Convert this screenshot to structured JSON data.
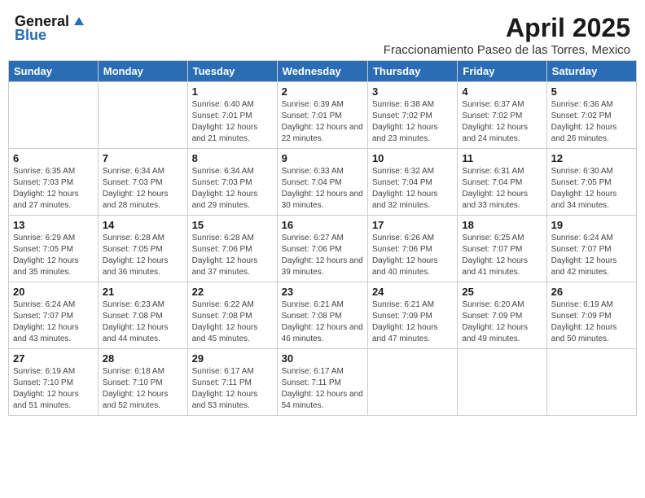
{
  "header": {
    "logo_general": "General",
    "logo_blue": "Blue",
    "title": "April 2025",
    "subtitle": "Fraccionamiento Paseo de las Torres, Mexico"
  },
  "weekdays": [
    "Sunday",
    "Monday",
    "Tuesday",
    "Wednesday",
    "Thursday",
    "Friday",
    "Saturday"
  ],
  "weeks": [
    [
      {
        "day": "",
        "info": ""
      },
      {
        "day": "",
        "info": ""
      },
      {
        "day": "1",
        "info": "Sunrise: 6:40 AM\nSunset: 7:01 PM\nDaylight: 12 hours and 21 minutes."
      },
      {
        "day": "2",
        "info": "Sunrise: 6:39 AM\nSunset: 7:01 PM\nDaylight: 12 hours and 22 minutes."
      },
      {
        "day": "3",
        "info": "Sunrise: 6:38 AM\nSunset: 7:02 PM\nDaylight: 12 hours and 23 minutes."
      },
      {
        "day": "4",
        "info": "Sunrise: 6:37 AM\nSunset: 7:02 PM\nDaylight: 12 hours and 24 minutes."
      },
      {
        "day": "5",
        "info": "Sunrise: 6:36 AM\nSunset: 7:02 PM\nDaylight: 12 hours and 26 minutes."
      }
    ],
    [
      {
        "day": "6",
        "info": "Sunrise: 6:35 AM\nSunset: 7:03 PM\nDaylight: 12 hours and 27 minutes."
      },
      {
        "day": "7",
        "info": "Sunrise: 6:34 AM\nSunset: 7:03 PM\nDaylight: 12 hours and 28 minutes."
      },
      {
        "day": "8",
        "info": "Sunrise: 6:34 AM\nSunset: 7:03 PM\nDaylight: 12 hours and 29 minutes."
      },
      {
        "day": "9",
        "info": "Sunrise: 6:33 AM\nSunset: 7:04 PM\nDaylight: 12 hours and 30 minutes."
      },
      {
        "day": "10",
        "info": "Sunrise: 6:32 AM\nSunset: 7:04 PM\nDaylight: 12 hours and 32 minutes."
      },
      {
        "day": "11",
        "info": "Sunrise: 6:31 AM\nSunset: 7:04 PM\nDaylight: 12 hours and 33 minutes."
      },
      {
        "day": "12",
        "info": "Sunrise: 6:30 AM\nSunset: 7:05 PM\nDaylight: 12 hours and 34 minutes."
      }
    ],
    [
      {
        "day": "13",
        "info": "Sunrise: 6:29 AM\nSunset: 7:05 PM\nDaylight: 12 hours and 35 minutes."
      },
      {
        "day": "14",
        "info": "Sunrise: 6:28 AM\nSunset: 7:05 PM\nDaylight: 12 hours and 36 minutes."
      },
      {
        "day": "15",
        "info": "Sunrise: 6:28 AM\nSunset: 7:06 PM\nDaylight: 12 hours and 37 minutes."
      },
      {
        "day": "16",
        "info": "Sunrise: 6:27 AM\nSunset: 7:06 PM\nDaylight: 12 hours and 39 minutes."
      },
      {
        "day": "17",
        "info": "Sunrise: 6:26 AM\nSunset: 7:06 PM\nDaylight: 12 hours and 40 minutes."
      },
      {
        "day": "18",
        "info": "Sunrise: 6:25 AM\nSunset: 7:07 PM\nDaylight: 12 hours and 41 minutes."
      },
      {
        "day": "19",
        "info": "Sunrise: 6:24 AM\nSunset: 7:07 PM\nDaylight: 12 hours and 42 minutes."
      }
    ],
    [
      {
        "day": "20",
        "info": "Sunrise: 6:24 AM\nSunset: 7:07 PM\nDaylight: 12 hours and 43 minutes."
      },
      {
        "day": "21",
        "info": "Sunrise: 6:23 AM\nSunset: 7:08 PM\nDaylight: 12 hours and 44 minutes."
      },
      {
        "day": "22",
        "info": "Sunrise: 6:22 AM\nSunset: 7:08 PM\nDaylight: 12 hours and 45 minutes."
      },
      {
        "day": "23",
        "info": "Sunrise: 6:21 AM\nSunset: 7:08 PM\nDaylight: 12 hours and 46 minutes."
      },
      {
        "day": "24",
        "info": "Sunrise: 6:21 AM\nSunset: 7:09 PM\nDaylight: 12 hours and 47 minutes."
      },
      {
        "day": "25",
        "info": "Sunrise: 6:20 AM\nSunset: 7:09 PM\nDaylight: 12 hours and 49 minutes."
      },
      {
        "day": "26",
        "info": "Sunrise: 6:19 AM\nSunset: 7:09 PM\nDaylight: 12 hours and 50 minutes."
      }
    ],
    [
      {
        "day": "27",
        "info": "Sunrise: 6:19 AM\nSunset: 7:10 PM\nDaylight: 12 hours and 51 minutes."
      },
      {
        "day": "28",
        "info": "Sunrise: 6:18 AM\nSunset: 7:10 PM\nDaylight: 12 hours and 52 minutes."
      },
      {
        "day": "29",
        "info": "Sunrise: 6:17 AM\nSunset: 7:11 PM\nDaylight: 12 hours and 53 minutes."
      },
      {
        "day": "30",
        "info": "Sunrise: 6:17 AM\nSunset: 7:11 PM\nDaylight: 12 hours and 54 minutes."
      },
      {
        "day": "",
        "info": ""
      },
      {
        "day": "",
        "info": ""
      },
      {
        "day": "",
        "info": ""
      }
    ]
  ]
}
